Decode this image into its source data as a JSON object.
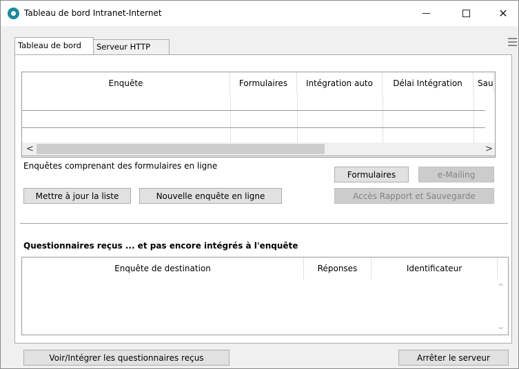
{
  "window": {
    "title": "Tableau de bord Intranet-Internet",
    "controls": {
      "minimize": "minimize",
      "maximize": "maximize",
      "close": "✕"
    }
  },
  "tabs": [
    {
      "label": "Tableau de bord",
      "active": true
    },
    {
      "label": "Serveur HTTP",
      "active": false
    }
  ],
  "surveys_grid": {
    "columns": [
      "Enquête",
      "Formulaires",
      "Intégration auto",
      "Délai Intégration",
      "Sau"
    ],
    "rows": [
      [
        "",
        "",
        "",
        "",
        ""
      ],
      [
        "",
        "",
        "",
        "",
        ""
      ]
    ],
    "scroll_left": "<",
    "scroll_right": ">"
  },
  "surveys_caption": "Enquêtes comprenant des formulaires en ligne",
  "buttons": {
    "update_list": "Mettre à jour la liste",
    "new_online_survey": "Nouvelle enquête en ligne",
    "forms": "Formulaires",
    "emailing": "e-Mailing",
    "report_access": "Accès Rapport et Sauvegarde",
    "view_integrate": "Voir/Intégrer les questionnaires reçus",
    "stop_server": "Arrêter le serveur"
  },
  "received_caption": "Questionnaires reçus ... et pas encore intégrés à l'enquête",
  "received_grid": {
    "columns": [
      "Enquête de destination",
      "Réponses",
      "Identificateur"
    ],
    "rows": []
  },
  "colors": {
    "accent": "#1a8a9c",
    "window_bg": "#f0f0f0",
    "disabled_text": "#838383"
  }
}
